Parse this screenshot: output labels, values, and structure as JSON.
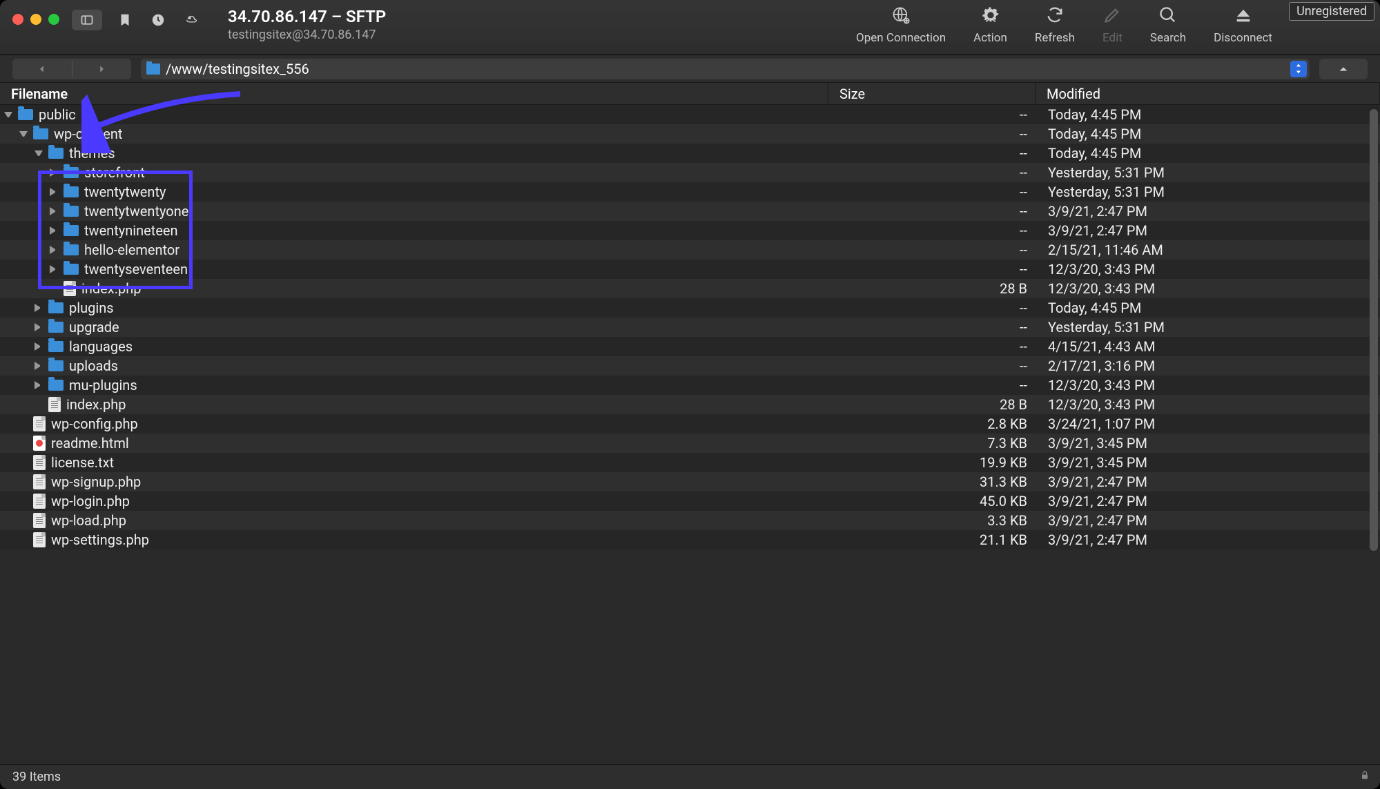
{
  "badge": "Unregistered",
  "title": "34.70.86.147 – SFTP",
  "subtitle": "testingsitex@34.70.86.147",
  "toolbar_actions": [
    {
      "label": "Open Connection",
      "icon": "globe",
      "disabled": false
    },
    {
      "label": "Action",
      "icon": "gear",
      "disabled": false
    },
    {
      "label": "Refresh",
      "icon": "refresh",
      "disabled": false
    },
    {
      "label": "Edit",
      "icon": "pencil",
      "disabled": true
    },
    {
      "label": "Search",
      "icon": "search",
      "disabled": false
    },
    {
      "label": "Disconnect",
      "icon": "eject",
      "disabled": false
    }
  ],
  "path": "/www/testingsitex_556",
  "columns": {
    "filename": "Filename",
    "size": "Size",
    "modified": "Modified"
  },
  "rows": [
    {
      "depth": 0,
      "disclosure": "down",
      "type": "folder",
      "name": "public",
      "size": "--",
      "modified": "Today, 4:45 PM",
      "highlighted": false
    },
    {
      "depth": 1,
      "disclosure": "down",
      "type": "folder",
      "name": "wp-content",
      "size": "--",
      "modified": "Today, 4:45 PM",
      "highlighted": false
    },
    {
      "depth": 2,
      "disclosure": "down",
      "type": "folder",
      "name": "themes",
      "size": "--",
      "modified": "Today, 4:45 PM",
      "highlighted": false
    },
    {
      "depth": 3,
      "disclosure": "right",
      "type": "folder",
      "name": "storefront",
      "size": "--",
      "modified": "Yesterday, 5:31 PM",
      "highlighted": true
    },
    {
      "depth": 3,
      "disclosure": "right",
      "type": "folder",
      "name": "twentytwenty",
      "size": "--",
      "modified": "Yesterday, 5:31 PM",
      "highlighted": true
    },
    {
      "depth": 3,
      "disclosure": "right",
      "type": "folder",
      "name": "twentytwentyone",
      "size": "--",
      "modified": "3/9/21, 2:47 PM",
      "highlighted": true
    },
    {
      "depth": 3,
      "disclosure": "right",
      "type": "folder",
      "name": "twentynineteen",
      "size": "--",
      "modified": "3/9/21, 2:47 PM",
      "highlighted": true
    },
    {
      "depth": 3,
      "disclosure": "right",
      "type": "folder",
      "name": "hello-elementor",
      "size": "--",
      "modified": "2/15/21, 11:46 AM",
      "highlighted": true
    },
    {
      "depth": 3,
      "disclosure": "right",
      "type": "folder",
      "name": "twentyseventeen",
      "size": "--",
      "modified": "12/3/20, 3:43 PM",
      "highlighted": true
    },
    {
      "depth": 3,
      "disclosure": "",
      "type": "file",
      "name": "index.php",
      "size": "28 B",
      "modified": "12/3/20, 3:43 PM",
      "highlighted": false
    },
    {
      "depth": 2,
      "disclosure": "right",
      "type": "folder",
      "name": "plugins",
      "size": "--",
      "modified": "Today, 4:45 PM",
      "highlighted": false
    },
    {
      "depth": 2,
      "disclosure": "right",
      "type": "folder",
      "name": "upgrade",
      "size": "--",
      "modified": "Yesterday, 5:31 PM",
      "highlighted": false
    },
    {
      "depth": 2,
      "disclosure": "right",
      "type": "folder",
      "name": "languages",
      "size": "--",
      "modified": "4/15/21, 4:43 AM",
      "highlighted": false
    },
    {
      "depth": 2,
      "disclosure": "right",
      "type": "folder",
      "name": "uploads",
      "size": "--",
      "modified": "2/17/21, 3:16 PM",
      "highlighted": false
    },
    {
      "depth": 2,
      "disclosure": "right",
      "type": "folder",
      "name": "mu-plugins",
      "size": "--",
      "modified": "12/3/20, 3:43 PM",
      "highlighted": false
    },
    {
      "depth": 2,
      "disclosure": "",
      "type": "file",
      "name": "index.php",
      "size": "28 B",
      "modified": "12/3/20, 3:43 PM",
      "highlighted": false
    },
    {
      "depth": 1,
      "disclosure": "",
      "type": "file",
      "name": "wp-config.php",
      "size": "2.8 KB",
      "modified": "3/24/21, 1:07 PM",
      "highlighted": false
    },
    {
      "depth": 1,
      "disclosure": "",
      "type": "html",
      "name": "readme.html",
      "size": "7.3 KB",
      "modified": "3/9/21, 3:45 PM",
      "highlighted": false
    },
    {
      "depth": 1,
      "disclosure": "",
      "type": "file",
      "name": "license.txt",
      "size": "19.9 KB",
      "modified": "3/9/21, 3:45 PM",
      "highlighted": false
    },
    {
      "depth": 1,
      "disclosure": "",
      "type": "file",
      "name": "wp-signup.php",
      "size": "31.3 KB",
      "modified": "3/9/21, 2:47 PM",
      "highlighted": false
    },
    {
      "depth": 1,
      "disclosure": "",
      "type": "file",
      "name": "wp-login.php",
      "size": "45.0 KB",
      "modified": "3/9/21, 2:47 PM",
      "highlighted": false
    },
    {
      "depth": 1,
      "disclosure": "",
      "type": "file",
      "name": "wp-load.php",
      "size": "3.3 KB",
      "modified": "3/9/21, 2:47 PM",
      "highlighted": false
    },
    {
      "depth": 1,
      "disclosure": "",
      "type": "file",
      "name": "wp-settings.php",
      "size": "21.1 KB",
      "modified": "3/9/21, 2:47 PM",
      "highlighted": false
    }
  ],
  "status": "39 Items"
}
